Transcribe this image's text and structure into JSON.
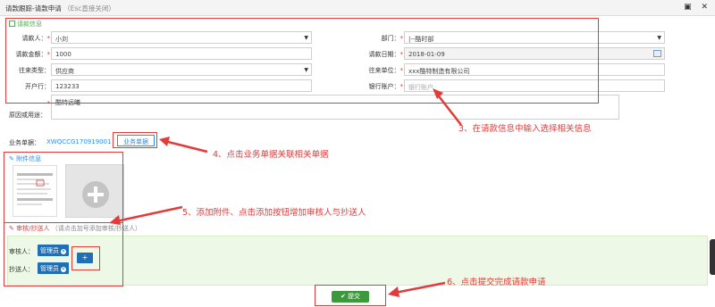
{
  "window": {
    "title": "请款跟踪-请款申请",
    "hint": "（Esc直接关闭）"
  },
  "info_section": {
    "title": "请款信息",
    "fields": {
      "applicant": {
        "label": "请款人：",
        "value": "小刘"
      },
      "department": {
        "label": "部门：",
        "value": "|--酷时部"
      },
      "amount": {
        "label": "请款金额：",
        "value": "1000"
      },
      "date": {
        "label": "请款日期：",
        "value": "2018-01-09"
      },
      "contact_type": {
        "label": "往来类型：",
        "value": "供应商"
      },
      "contact_unit": {
        "label": "往来单位：",
        "value": "xxx酷特制造有限公司"
      },
      "bank": {
        "label": "开户行：",
        "value": "123233"
      },
      "bank_account": {
        "label": "银行账户：",
        "placeholder": "银行账户"
      },
      "purpose": {
        "label": "原因或用途：",
        "value": "酷特远曦"
      }
    }
  },
  "business": {
    "label": "业务单据：",
    "doc_no": "XWQCCG170919001",
    "button": "业务单据"
  },
  "attachment_section": {
    "title": "附件信息"
  },
  "approver_section": {
    "title": "审核/抄送人",
    "hint": "（请点击加号添加审核/抄送人）",
    "approver_label": "审核人：",
    "approver_tag": "管理员",
    "cc_label": "抄送人：",
    "cc_tag": "管理员",
    "add_symbol": "+"
  },
  "submit": {
    "label": "提交",
    "icon": "check-icon"
  },
  "annotations": {
    "note3": "3、在请款信息中输入选择相关信息",
    "note4": "4、点击业务单据关联相关单据",
    "note5": "5、添加附件、点击添加按钮增加审核人与抄送人",
    "note6": "6、点击提交完成请款申请"
  },
  "colors": {
    "annotation": "#e23b3b",
    "accent": "#2d8cf0",
    "section_green": "#4caf50",
    "tag_blue": "#1e6fb5",
    "submit_green": "#3c9a3c"
  }
}
